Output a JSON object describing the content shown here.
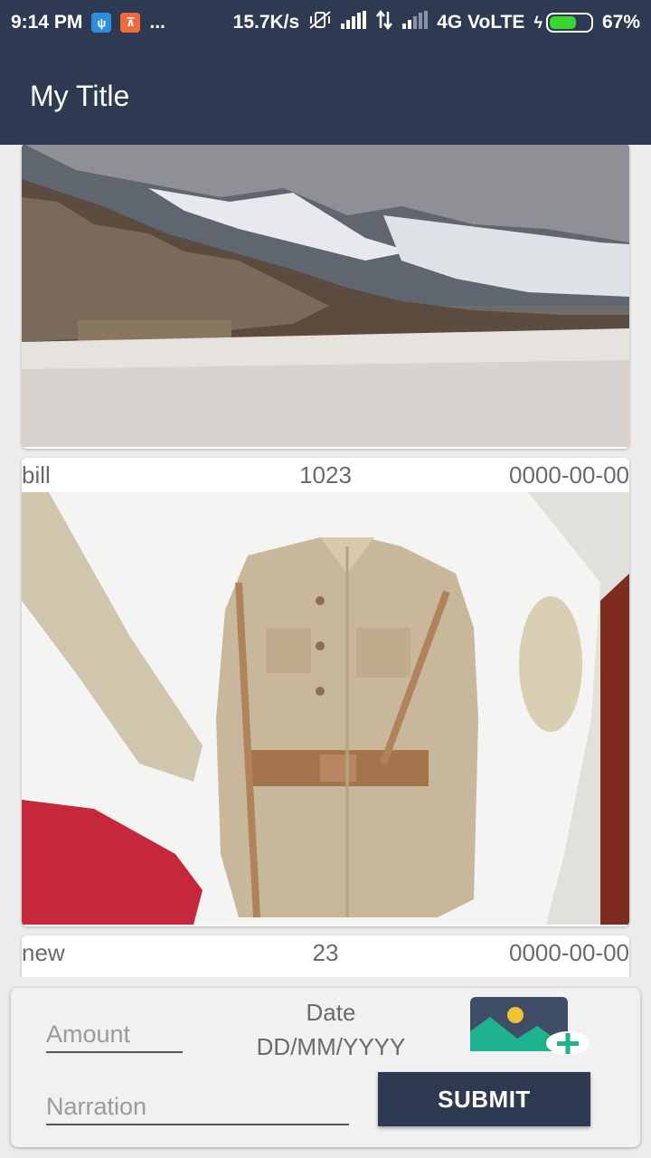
{
  "status_bar": {
    "time": "9:14 PM",
    "more": "...",
    "speed": "15.7K/s",
    "network": "4G VoLTE",
    "battery": "67%",
    "battery_level": 0.67
  },
  "app_bar": {
    "title": "My Title"
  },
  "list": {
    "items": [
      {
        "name": "bill",
        "amount": "1023",
        "date": "0000-00-00",
        "image": "jacket-photo"
      },
      {
        "name": "new",
        "amount": "23",
        "date": "0000-00-00",
        "image": "photo"
      }
    ]
  },
  "form": {
    "amount_placeholder": "Amount",
    "date_label": "Date",
    "date_value": "DD/MM/YYYY",
    "narration_placeholder": "Narration",
    "submit_label": "SUBMIT",
    "image_icon": "add-photo-icon"
  },
  "colors": {
    "primary": "#2e3a51",
    "accent": "#1fb28e"
  }
}
